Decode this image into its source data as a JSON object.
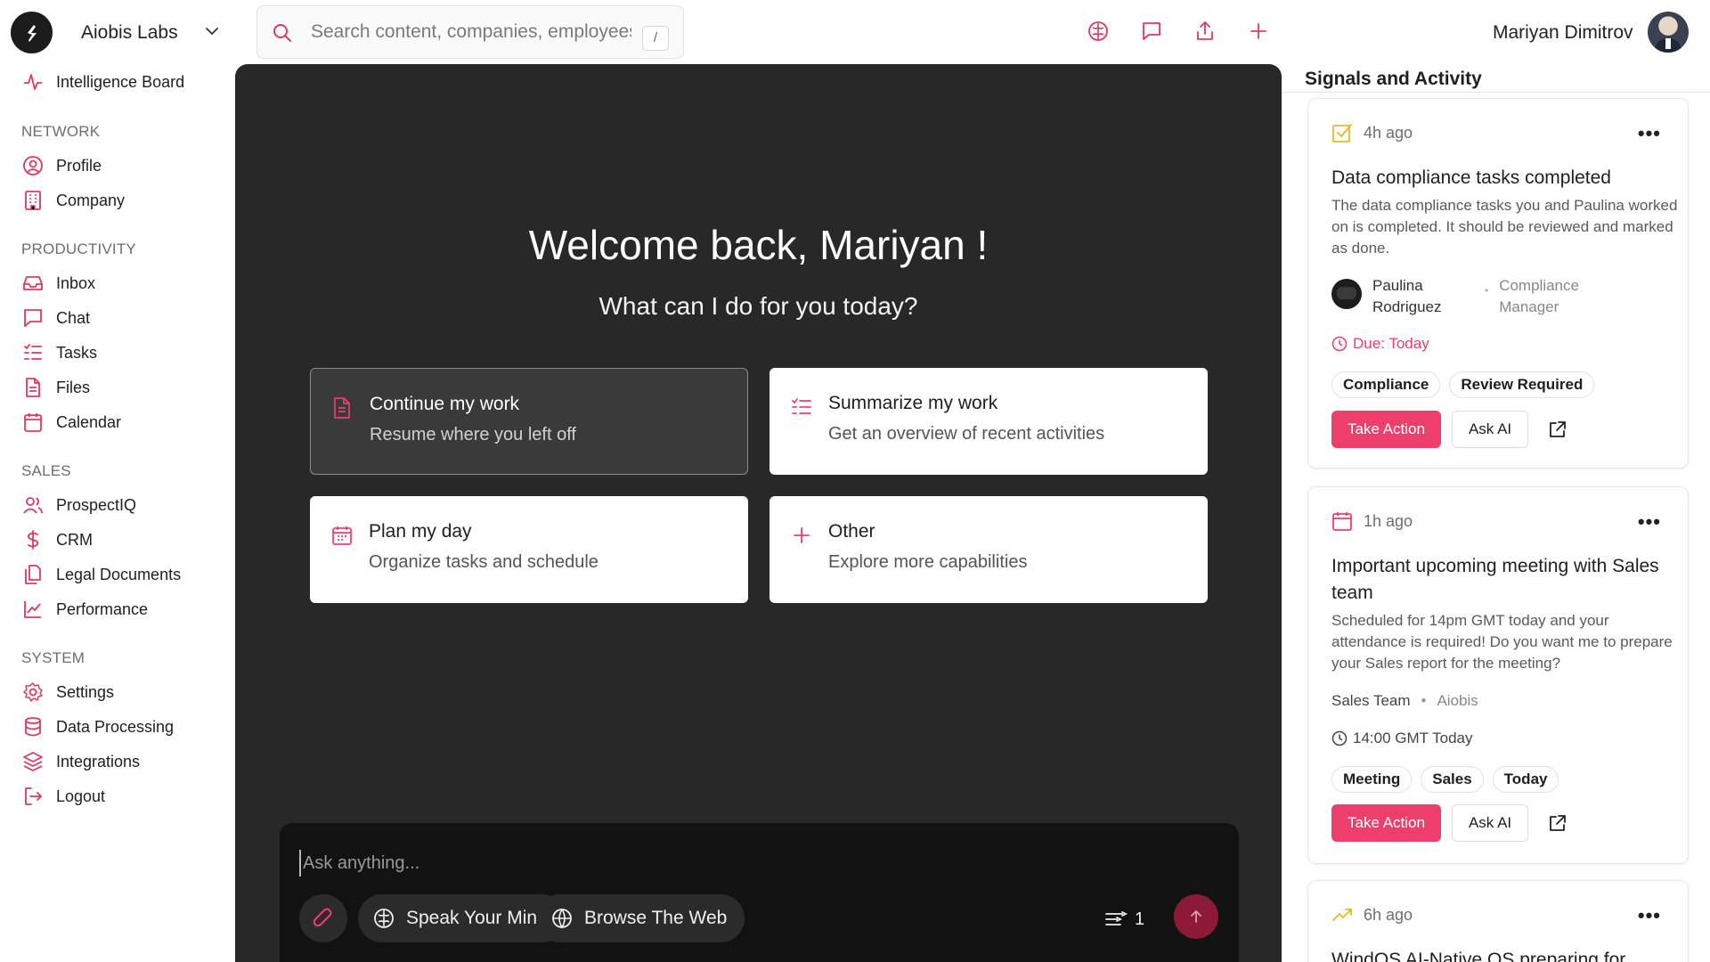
{
  "topbar": {
    "org_name": "Aiobis Labs",
    "search_placeholder": "Search content, companies, employees...",
    "search_shortcut": "/",
    "user_name": "Mariyan Dimitrov"
  },
  "sidebar": {
    "top_item": "Intelligence Board",
    "sections": {
      "network": "NETWORK",
      "productivity": "PRODUCTIVITY",
      "sales": "SALES",
      "system": "SYSTEM"
    },
    "network_items": [
      "Profile",
      "Company"
    ],
    "productivity_items": [
      "Inbox",
      "Chat",
      "Tasks",
      "Files",
      "Calendar"
    ],
    "sales_items": [
      "ProspectIQ",
      "CRM",
      "Legal Documents",
      "Performance"
    ],
    "system_items": [
      "Settings",
      "Data Processing",
      "Integrations",
      "Logout"
    ]
  },
  "main": {
    "welcome": "Welcome back, Mariyan !",
    "subtitle": "What can I do for you today?",
    "cards": [
      {
        "title": "Continue my work",
        "subtitle": "Resume where you left off"
      },
      {
        "title": "Summarize my work",
        "subtitle": "Get an overview of recent activities"
      },
      {
        "title": "Plan my day",
        "subtitle": "Organize tasks and schedule"
      },
      {
        "title": "Other",
        "subtitle": "Explore more capabilities"
      }
    ],
    "composer": {
      "placeholder": "Ask anything...",
      "speak_label": "Speak Your Mind",
      "browse_label": "Browse The Web",
      "model_count": "1"
    }
  },
  "signals": {
    "title": "Signals and Activity",
    "cards": [
      {
        "time": "4h ago",
        "title": "Data compliance tasks completed",
        "description": "The data compliance tasks you and Paulina worked on is completed. It should be reviewed and marked as done.",
        "person_name": "Paulina Rodriguez",
        "person_role": "Compliance Manager",
        "due": "Due: Today",
        "tags": [
          "Compliance",
          "Review Required"
        ],
        "primary_action": "Take Action",
        "secondary_action": "Ask AI"
      },
      {
        "time": "1h ago",
        "title": "Important upcoming meeting with Sales team",
        "description": "Scheduled for 14pm GMT today and your attendance is required! Do you want me to prepare your Sales report for the meeting?",
        "meta_left": "Sales Team",
        "meta_right": "Aiobis",
        "when": "14:00 GMT Today",
        "tags": [
          "Meeting",
          "Sales",
          "Today"
        ],
        "primary_action": "Take Action",
        "secondary_action": "Ask AI"
      },
      {
        "time": "6h ago",
        "title": "WindOS AI-Native OS preparing for"
      }
    ]
  },
  "colors": {
    "accent": "#ee3e6d",
    "main_bg": "#282828",
    "composer_bg": "#121212",
    "send_bg": "#8c1a36",
    "task_icon": "#e8b923"
  },
  "icons": {
    "logo": "aiobis-logo-icon",
    "search": "search-icon",
    "brain": "brain-icon",
    "chat": "chat-bubble-icon",
    "share": "share-upload-icon",
    "plus": "plus-icon",
    "send": "arrow-up-icon"
  }
}
